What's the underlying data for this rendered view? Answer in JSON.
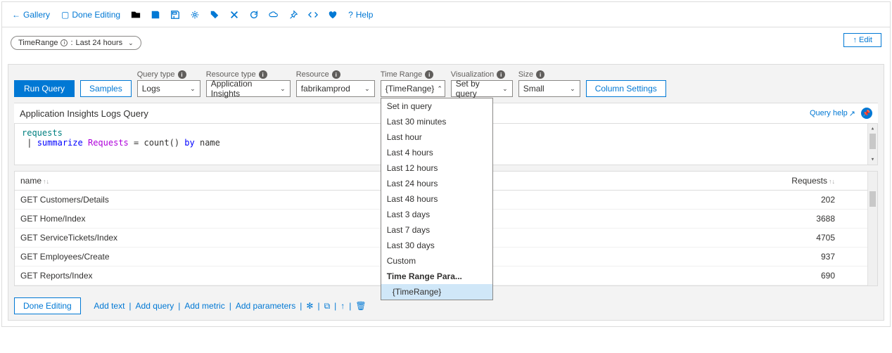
{
  "toolbar": {
    "gallery": "Gallery",
    "doneEditing": "Done Editing",
    "help": "Help"
  },
  "pill": {
    "name": "TimeRange",
    "value": "Last 24 hours"
  },
  "editText": "Edit",
  "controls": {
    "runQuery": "Run Query",
    "samples": "Samples",
    "queryTypeLabel": "Query type",
    "queryTypeValue": "Logs",
    "resourceTypeLabel": "Resource type",
    "resourceTypeValue": "Application Insights",
    "resourceLabel": "Resource",
    "resourceValue": "fabrikamprod",
    "timeRangeLabel": "Time Range",
    "timeRangeValue": "{TimeRange}",
    "visualizationLabel": "Visualization",
    "visualizationValue": "Set by query",
    "sizeLabel": "Size",
    "sizeValue": "Small",
    "columnSettings": "Column Settings"
  },
  "dropdown": {
    "items": [
      "Set in query",
      "Last 30 minutes",
      "Last hour",
      "Last 4 hours",
      "Last 12 hours",
      "Last 24 hours",
      "Last 48 hours",
      "Last 3 days",
      "Last 7 days",
      "Last 30 days",
      "Custom"
    ],
    "headerLabel": "Time Range Para...",
    "selected": "{TimeRange}"
  },
  "query": {
    "title": "Application Insights Logs Query",
    "help": "Query help",
    "line1_kw": "requests",
    "line2_pipe": "|",
    "line2_kw1": "summarize",
    "line2_ident": "Requests",
    "line2_eq": "=",
    "line2_fn": "count()",
    "line2_kw2": "by",
    "line2_col": "name"
  },
  "table": {
    "col1": "name",
    "col2": "Requests",
    "rows": [
      {
        "name": "GET Customers/Details",
        "requests": 202
      },
      {
        "name": "GET Home/Index",
        "requests": 3688
      },
      {
        "name": "GET ServiceTickets/Index",
        "requests": 4705
      },
      {
        "name": "GET Employees/Create",
        "requests": 937
      },
      {
        "name": "GET Reports/Index",
        "requests": 690
      }
    ]
  },
  "bottom": {
    "doneEditing": "Done Editing",
    "addText": "Add text",
    "addQuery": "Add query",
    "addMetric": "Add metric",
    "addParameters": "Add parameters"
  }
}
